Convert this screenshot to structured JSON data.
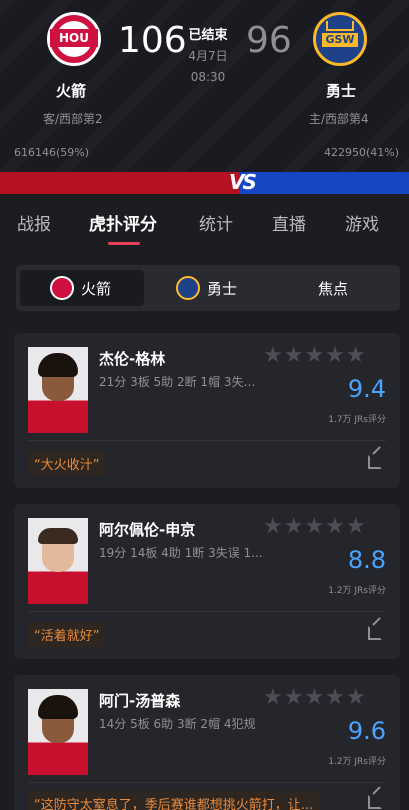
{
  "header": {
    "home_team": {
      "name": "火箭",
      "abbr": "HOU",
      "sub": "客/西部第2",
      "score": "106",
      "support": "616146(59%)"
    },
    "away_team": {
      "name": "勇士",
      "abbr": "GSW",
      "sub": "主/西部第4",
      "score": "96",
      "support": "422950(41%)"
    },
    "status": "已结束",
    "date": "4月7日",
    "time": "08:30"
  },
  "vs_label": "VS",
  "tabs": [
    "战报",
    "虎扑评分",
    "统计",
    "直播",
    "游戏"
  ],
  "active_tab": 1,
  "segment": {
    "items": [
      "火箭",
      "勇士",
      "焦点"
    ],
    "active": 0
  },
  "players": [
    {
      "name": "杰伦-格林",
      "stats": "21分 3板 5助 2断 1帽 3失误 ...",
      "rating": "9.4",
      "votes": "1.7万 JRs评分",
      "comment": "“大火收汁”",
      "stars": "★★★★★"
    },
    {
      "name": "阿尔佩伦-申京",
      "stats": "19分 14板 4助 1断 3失误 1...",
      "rating": "8.8",
      "votes": "1.2万 JRs评分",
      "comment": "“活着就好”",
      "stars": "★★★★★"
    },
    {
      "name": "阿门-汤普森",
      "stats": "14分 5板 6助 3断 2帽 4犯规",
      "rating": "9.6",
      "votes": "1.2万 JRs评分",
      "comment": "“这防守太窒息了，季后赛谁都想挑火箭打，让...",
      "stars": "★★★★★"
    }
  ],
  "colors": {
    "accent": "#e8405a",
    "rating": "#4aa3ff",
    "comment": "#e88b3d",
    "hou_red": "#b41222",
    "gsw_blue": "#1746c4"
  }
}
